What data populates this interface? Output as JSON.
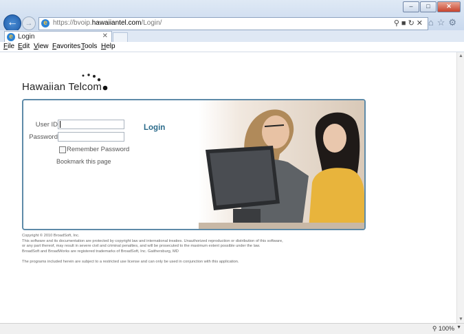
{
  "browser": {
    "url_prefix": "https://bvoip.",
    "url_host": "hawaiiantel.com",
    "url_path": "/Login/",
    "tab_title": "Login",
    "menu": [
      "File",
      "Edit",
      "View",
      "Favorites",
      "Tools",
      "Help"
    ],
    "zoom": "100%"
  },
  "logo": {
    "text": "Hawaiian Telcom"
  },
  "login": {
    "title": "Login",
    "user_id_label": "User ID",
    "password_label": "Password",
    "remember_label": "Remember Password",
    "bookmark_label": "Bookmark this page"
  },
  "footer": {
    "copyright": "Copyright © 2010 BroadSoft, Inc.",
    "line1": "This software and its documentation are protected by copyright law and international treaties. Unauthorized reproduction or distribution of this software,",
    "line2": "or any part thereof, may result in severe civil and criminal penalties, and will be prosecuted to the maximum extent possible under the law.",
    "line3": "BroadSoft and BroadWorks are registered trademarks of BroadSoft, Inc. Gaithersburg, MD",
    "line4": "The programs included herein are subject to a restricted use license and can only be used in conjunction with this application."
  },
  "colors": {
    "accent": "#2a6a8a",
    "panel_border": "#5d8aa8"
  },
  "icons": [
    "back-icon",
    "forward-icon",
    "ie-icon",
    "search-icon",
    "lock-icon",
    "refresh-icon",
    "stop-icon",
    "home-icon",
    "favorites-star-icon",
    "gear-icon",
    "zoom-icon"
  ]
}
